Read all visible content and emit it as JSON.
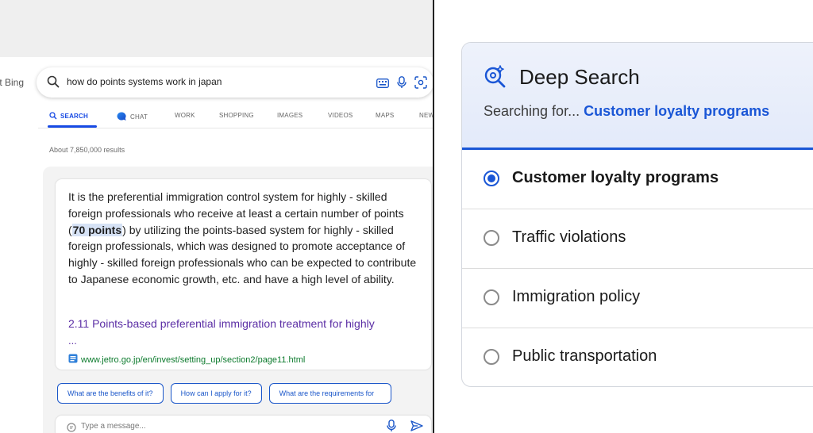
{
  "bing": {
    "brand_partial": "ft Bing",
    "search_query": "how do points systems work in japan",
    "tabs": [
      {
        "label": "SEARCH",
        "active": true,
        "icon": "search-icon"
      },
      {
        "label": "CHAT",
        "active": false,
        "icon": "chat-bubble-icon"
      },
      {
        "label": "WORK",
        "active": false
      },
      {
        "label": "SHOPPING",
        "active": false
      },
      {
        "label": "IMAGES",
        "active": false
      },
      {
        "label": "VIDEOS",
        "active": false
      },
      {
        "label": "MAPS",
        "active": false
      },
      {
        "label": "NEW",
        "active": false
      }
    ],
    "results_count": "About 7,850,000 results",
    "answer": {
      "text_before": "It is the preferential immigration control system for highly - skilled foreign professionals who receive at least a certain number of points (",
      "highlight": "70 points",
      "text_after": ") by utilizing the points-based system for highly - skilled foreign professionals, which was designed to promote acceptance of highly - skilled foreign professionals who can be expected to contribute to Japanese economic growth, etc. and have a high level of ability.",
      "source_title": "2.11 Points-based preferential immigration treatment for highly",
      "source_ellipsis": "...",
      "source_url": "www.jetro.go.jp/en/invest/setting_up/section2/page11.html"
    },
    "suggestions": [
      "What are the benefits of it?",
      "How can I apply for it?",
      "What are the requirements for"
    ],
    "message_placeholder": "Type a message..."
  },
  "deep_search": {
    "title": "Deep Search",
    "searching_prefix": "Searching for...",
    "searching_query": "Customer loyalty programs",
    "accent_color": "#1a56d6",
    "options": [
      {
        "label": "Customer loyalty programs",
        "selected": true
      },
      {
        "label": "Traffic violations",
        "selected": false
      },
      {
        "label": "Immigration policy",
        "selected": false
      },
      {
        "label": "Public transportation",
        "selected": false
      }
    ]
  }
}
